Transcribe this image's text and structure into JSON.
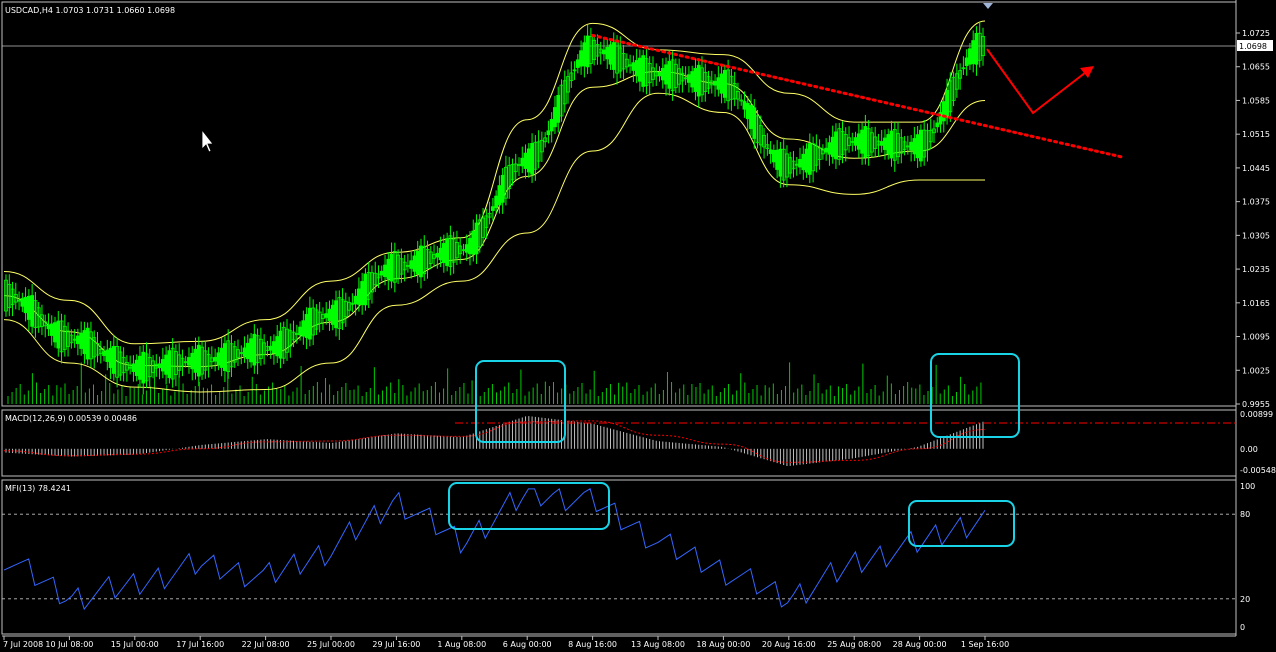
{
  "header": {
    "main_title": "USDCAD,H4  1.0703 1.0731 1.0660 1.0698",
    "macd_title": "MACD(12,26,9) 0.00539 0.00486",
    "mfi_title": "MFI(13) 78.4241",
    "current_price": "1.0698"
  },
  "colors": {
    "background": "#000000",
    "candle": "#00ff00",
    "bollinger": "#ffff66",
    "volume": "#00cc00",
    "trendline": "#ff0000",
    "arrow": "#ff0000",
    "highlight_box": "#19d3e6",
    "macd_hist": "#c0c0c0",
    "macd_signal": "#ff0000",
    "mfi_line": "#3366ff"
  },
  "chart_data": [
    {
      "type": "line",
      "title": "USDCAD,H4",
      "ohlc_last": {
        "open": 1.0703,
        "high": 1.0731,
        "low": 1.066,
        "close": 1.0698
      },
      "y_ticks": [
        "1.0725",
        "1.0655",
        "1.0585",
        "1.0515",
        "1.0445",
        "1.0375",
        "1.0305",
        "1.0235",
        "1.0165",
        "1.0095",
        "1.0025",
        "0.9955"
      ],
      "ylim": [
        0.9955,
        1.0725
      ],
      "x_ticks": [
        "7 Jul 2008",
        "10 Jul 08:00",
        "15 Jul 00:00",
        "17 Jul 16:00",
        "22 Jul 08:00",
        "25 Jul 00:00",
        "29 Jul 16:00",
        "1 Aug 08:00",
        "6 Aug 00:00",
        "8 Aug 16:00",
        "13 Aug 08:00",
        "18 Aug 00:00",
        "20 Aug 16:00",
        "25 Aug 08:00",
        "28 Aug 00:00",
        "1 Sep 16:00"
      ],
      "close_path": {
        "x": [
          "7 Jul 2008",
          "10 Jul 08:00",
          "15 Jul 00:00",
          "17 Jul 16:00",
          "22 Jul 08:00",
          "25 Jul 00:00",
          "29 Jul 16:00",
          "1 Aug 08:00",
          "6 Aug 00:00",
          "8 Aug 16:00",
          "13 Aug 08:00",
          "18 Aug 00:00",
          "20 Aug 16:00",
          "25 Aug 08:00",
          "28 Aug 00:00",
          "1 Sep 16:00"
        ],
        "values": [
          1.018,
          1.009,
          1.003,
          1.0045,
          1.007,
          1.014,
          1.024,
          1.0275,
          1.046,
          1.069,
          1.064,
          1.062,
          1.045,
          1.05,
          1.049,
          1.0698
        ]
      },
      "bollinger_upper": [
        1.023,
        1.017,
        1.008,
        1.0085,
        1.013,
        1.021,
        1.027,
        1.03,
        1.0545,
        1.0745,
        1.069,
        1.068,
        1.06,
        1.054,
        1.054,
        1.075
      ],
      "bollinger_lower": [
        1.013,
        1.004,
        0.999,
        0.998,
        0.9985,
        1.004,
        1.016,
        1.021,
        1.031,
        1.048,
        1.06,
        1.056,
        1.041,
        1.039,
        1.042,
        1.042
      ],
      "trendline": {
        "from": [
          "8 Aug 16:00",
          1.072
        ],
        "to": [
          "1 Sep 16:00",
          1.046
        ]
      }
    },
    {
      "type": "bar",
      "title": "MACD(12,26,9)",
      "values_text": [
        "0.00539",
        "0.00486"
      ],
      "y_ticks": [
        "0.00899",
        "0.00",
        "-0.00548"
      ],
      "ylim": [
        -0.00548,
        0.00899
      ],
      "histogram": [
        -0.001,
        -0.002,
        -0.0015,
        0.001,
        0.0025,
        0.0015,
        0.004,
        0.003,
        0.0085,
        0.0065,
        0.002,
        0.0005,
        -0.0045,
        -0.0025,
        0.0005,
        0.007
      ],
      "signal": [
        -0.0005,
        -0.0018,
        -0.0014,
        0.0,
        0.0018,
        0.002,
        0.0035,
        0.0032,
        0.007,
        0.0072,
        0.0035,
        0.0012,
        -0.0035,
        -0.003,
        0.0,
        0.005
      ]
    },
    {
      "type": "line",
      "title": "MFI(13)",
      "value_text": "78.4241",
      "y_ticks": [
        "100",
        "80",
        "20",
        "0"
      ],
      "ylim": [
        0,
        100
      ],
      "values": [
        50,
        20,
        30,
        45,
        35,
        55,
        90,
        60,
        95,
        90,
        60,
        40,
        20,
        45,
        60,
        78
      ]
    }
  ]
}
